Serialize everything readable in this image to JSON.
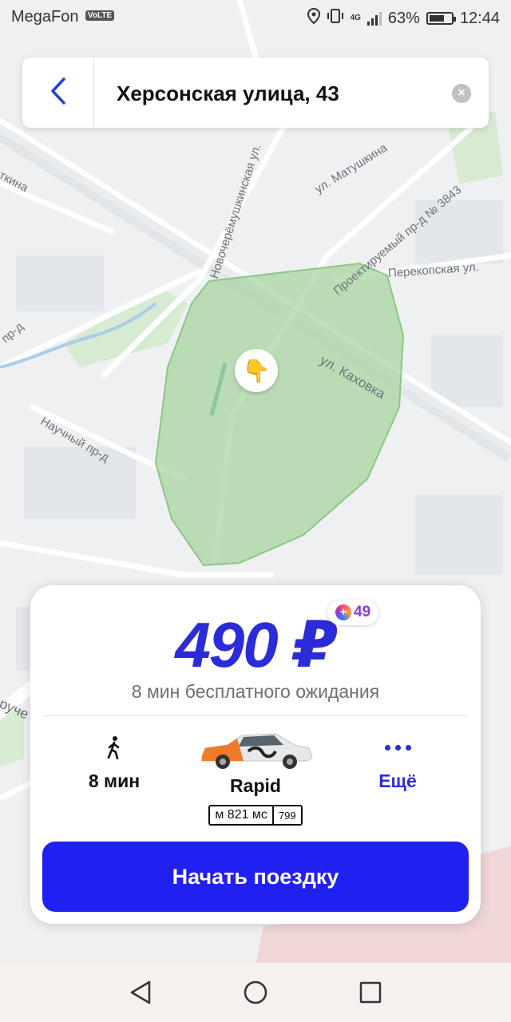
{
  "status_bar": {
    "carrier": "MegaFon",
    "volte": "VoLTE",
    "network": "4G",
    "battery": "63%",
    "time": "12:44"
  },
  "search": {
    "address": "Херсонская улица, 43",
    "back_icon": "chevron-left-icon",
    "clear_icon": "clear-icon"
  },
  "map": {
    "labels": [
      "ткина",
      "Новочерёмушкинская ул.",
      "ул. Матушкина",
      "Проектируемый пр-д № 3843",
      "Перекопская ул.",
      "ул. Каховка",
      "пр-д",
      "Научный пр-д",
      "руче"
    ],
    "pin_emoji": "👇"
  },
  "ride_card": {
    "price": "490 ₽",
    "plus_points": "49",
    "waiting_text": "8 мин бесплатного ожидания",
    "walk_time": "8 мин",
    "car_model": "Rapid",
    "plate_number": "м 821 мс",
    "plate_region": "799",
    "more_label": "Ещё",
    "start_button": "Начать поездку"
  },
  "colors": {
    "accent": "#2020f0",
    "price": "#2b2bd8",
    "zone_fill": "#a8d5a0"
  }
}
